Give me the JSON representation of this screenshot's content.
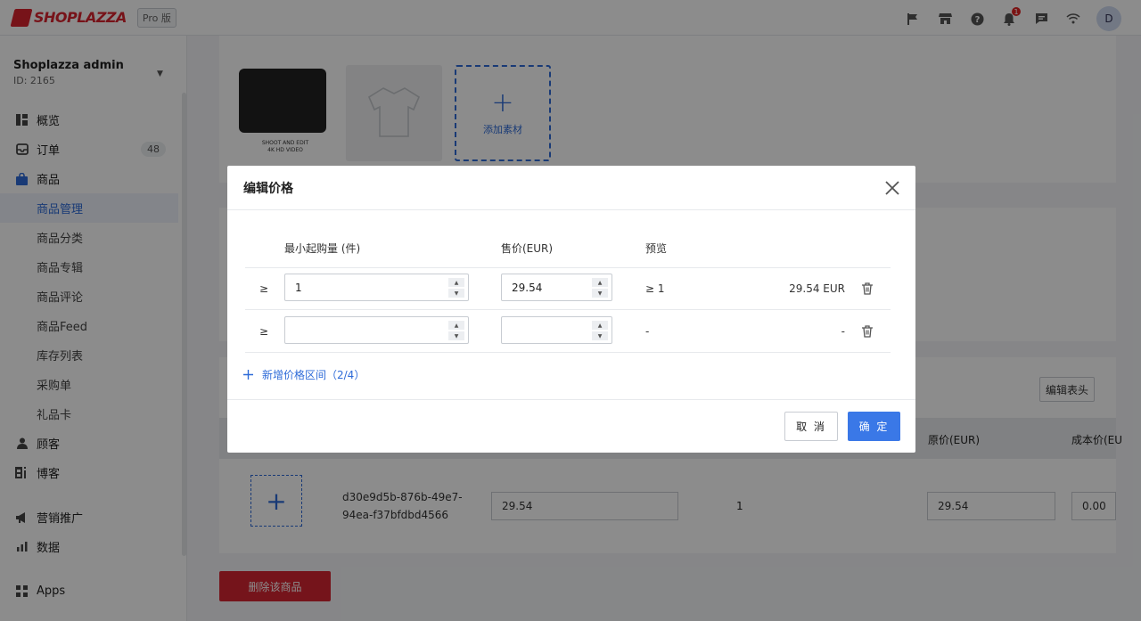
{
  "topbar": {
    "brand": "SHOPLAZZA",
    "plan_tag": "Pro 版",
    "notification_count": "1",
    "avatar_letter": "D"
  },
  "sidebar": {
    "store_name": "Shoplazza admin",
    "store_id": "ID: 2165",
    "items": [
      {
        "label": "概览",
        "icon": "dashboard-icon"
      },
      {
        "label": "订单",
        "icon": "inbox-icon",
        "count": "48"
      },
      {
        "label": "商品",
        "icon": "bag-icon"
      },
      {
        "label": "商品管理"
      },
      {
        "label": "商品分类"
      },
      {
        "label": "商品专辑"
      },
      {
        "label": "商品评论"
      },
      {
        "label": "商品Feed"
      },
      {
        "label": "库存列表"
      },
      {
        "label": "采购单"
      },
      {
        "label": "礼品卡"
      },
      {
        "label": "顾客",
        "icon": "user-icon"
      },
      {
        "label": "博客",
        "icon": "blog-icon"
      },
      {
        "label": "营销推广",
        "icon": "megaphone-icon"
      },
      {
        "label": "数据",
        "icon": "bar-chart-icon"
      },
      {
        "label": "Apps",
        "icon": "apps-icon"
      }
    ]
  },
  "background": {
    "thumb_caption_line1": "SHOOT AND EDIT",
    "thumb_caption_line2": "4K HD VIDEO",
    "add_material": "添加素材",
    "edit_columns": "编辑表头",
    "col_original_price": "原价(EUR)",
    "col_cost_price": "成本价(EU",
    "variant_id_line1": "d30e9d5b-876b-49e7-",
    "variant_id_line2": "94ea-f37bfdbd4566",
    "variant_price": "29.54",
    "variant_qty": "1",
    "variant_original_price": "29.54",
    "variant_cost": "0.00",
    "delete_product": "删除该商品"
  },
  "modal": {
    "title": "编辑价格",
    "col_min_qty": "最小起购量 (件)",
    "col_price": "售价(EUR)",
    "col_preview": "预览",
    "rows": [
      {
        "ge": "≥",
        "min_qty": "1",
        "price": "29.54",
        "preview_qty": "≥ 1",
        "preview_price": "29.54 EUR"
      },
      {
        "ge": "≥",
        "min_qty": "",
        "price": "",
        "preview_qty": "-",
        "preview_price": "-"
      }
    ],
    "add_range": "新增价格区间（2/4）",
    "cancel": "取 消",
    "confirm": "确 定"
  }
}
